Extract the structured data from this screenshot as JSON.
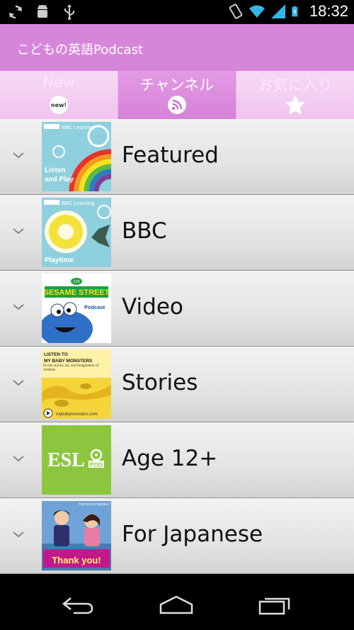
{
  "status_bar": {
    "time": "18:32",
    "icons": [
      "sync-icon",
      "android-debug-icon",
      "usb-icon",
      "vibrate-icon",
      "wifi-icon",
      "signal-icon",
      "battery-charging-icon"
    ]
  },
  "app": {
    "title": "こどもの英語Podcast",
    "accent": "#d686d9"
  },
  "tabs": [
    {
      "label": "New",
      "icon": "new-badge-icon",
      "active": false
    },
    {
      "label": "チャンネル",
      "icon": "rss-icon",
      "active": true
    },
    {
      "label": "お気に入り",
      "icon": "star-icon",
      "active": false
    }
  ],
  "new_badge_text": "new!",
  "channels": [
    {
      "label": "Featured",
      "thumb": {
        "brand": "BBC Learning",
        "text1": "Listen",
        "text2": "and Play"
      }
    },
    {
      "label": "BBC",
      "thumb": {
        "brand": "BBC Learning",
        "text1": "Playtime"
      }
    },
    {
      "label": "Video",
      "thumb": {
        "num": "123",
        "text1": "SESAME STREET",
        "text2": "Podcast"
      }
    },
    {
      "label": "Stories",
      "thumb": {
        "text1": "LISTEN TO",
        "text2": "MY BABY MONSTERS",
        "text3": "for the stories, art, and imagination of children",
        "text4": "mybabymonsters.com"
      }
    },
    {
      "label": "Age 12+",
      "thumb": {
        "text1": "ESL",
        "text2": "POD"
      }
    },
    {
      "label": "For Japanese",
      "thumb": {
        "text1": "THE RADIO WEEKLY",
        "text2": "Thank you!"
      }
    }
  ],
  "nav": [
    "back-icon",
    "home-icon",
    "recents-icon"
  ]
}
